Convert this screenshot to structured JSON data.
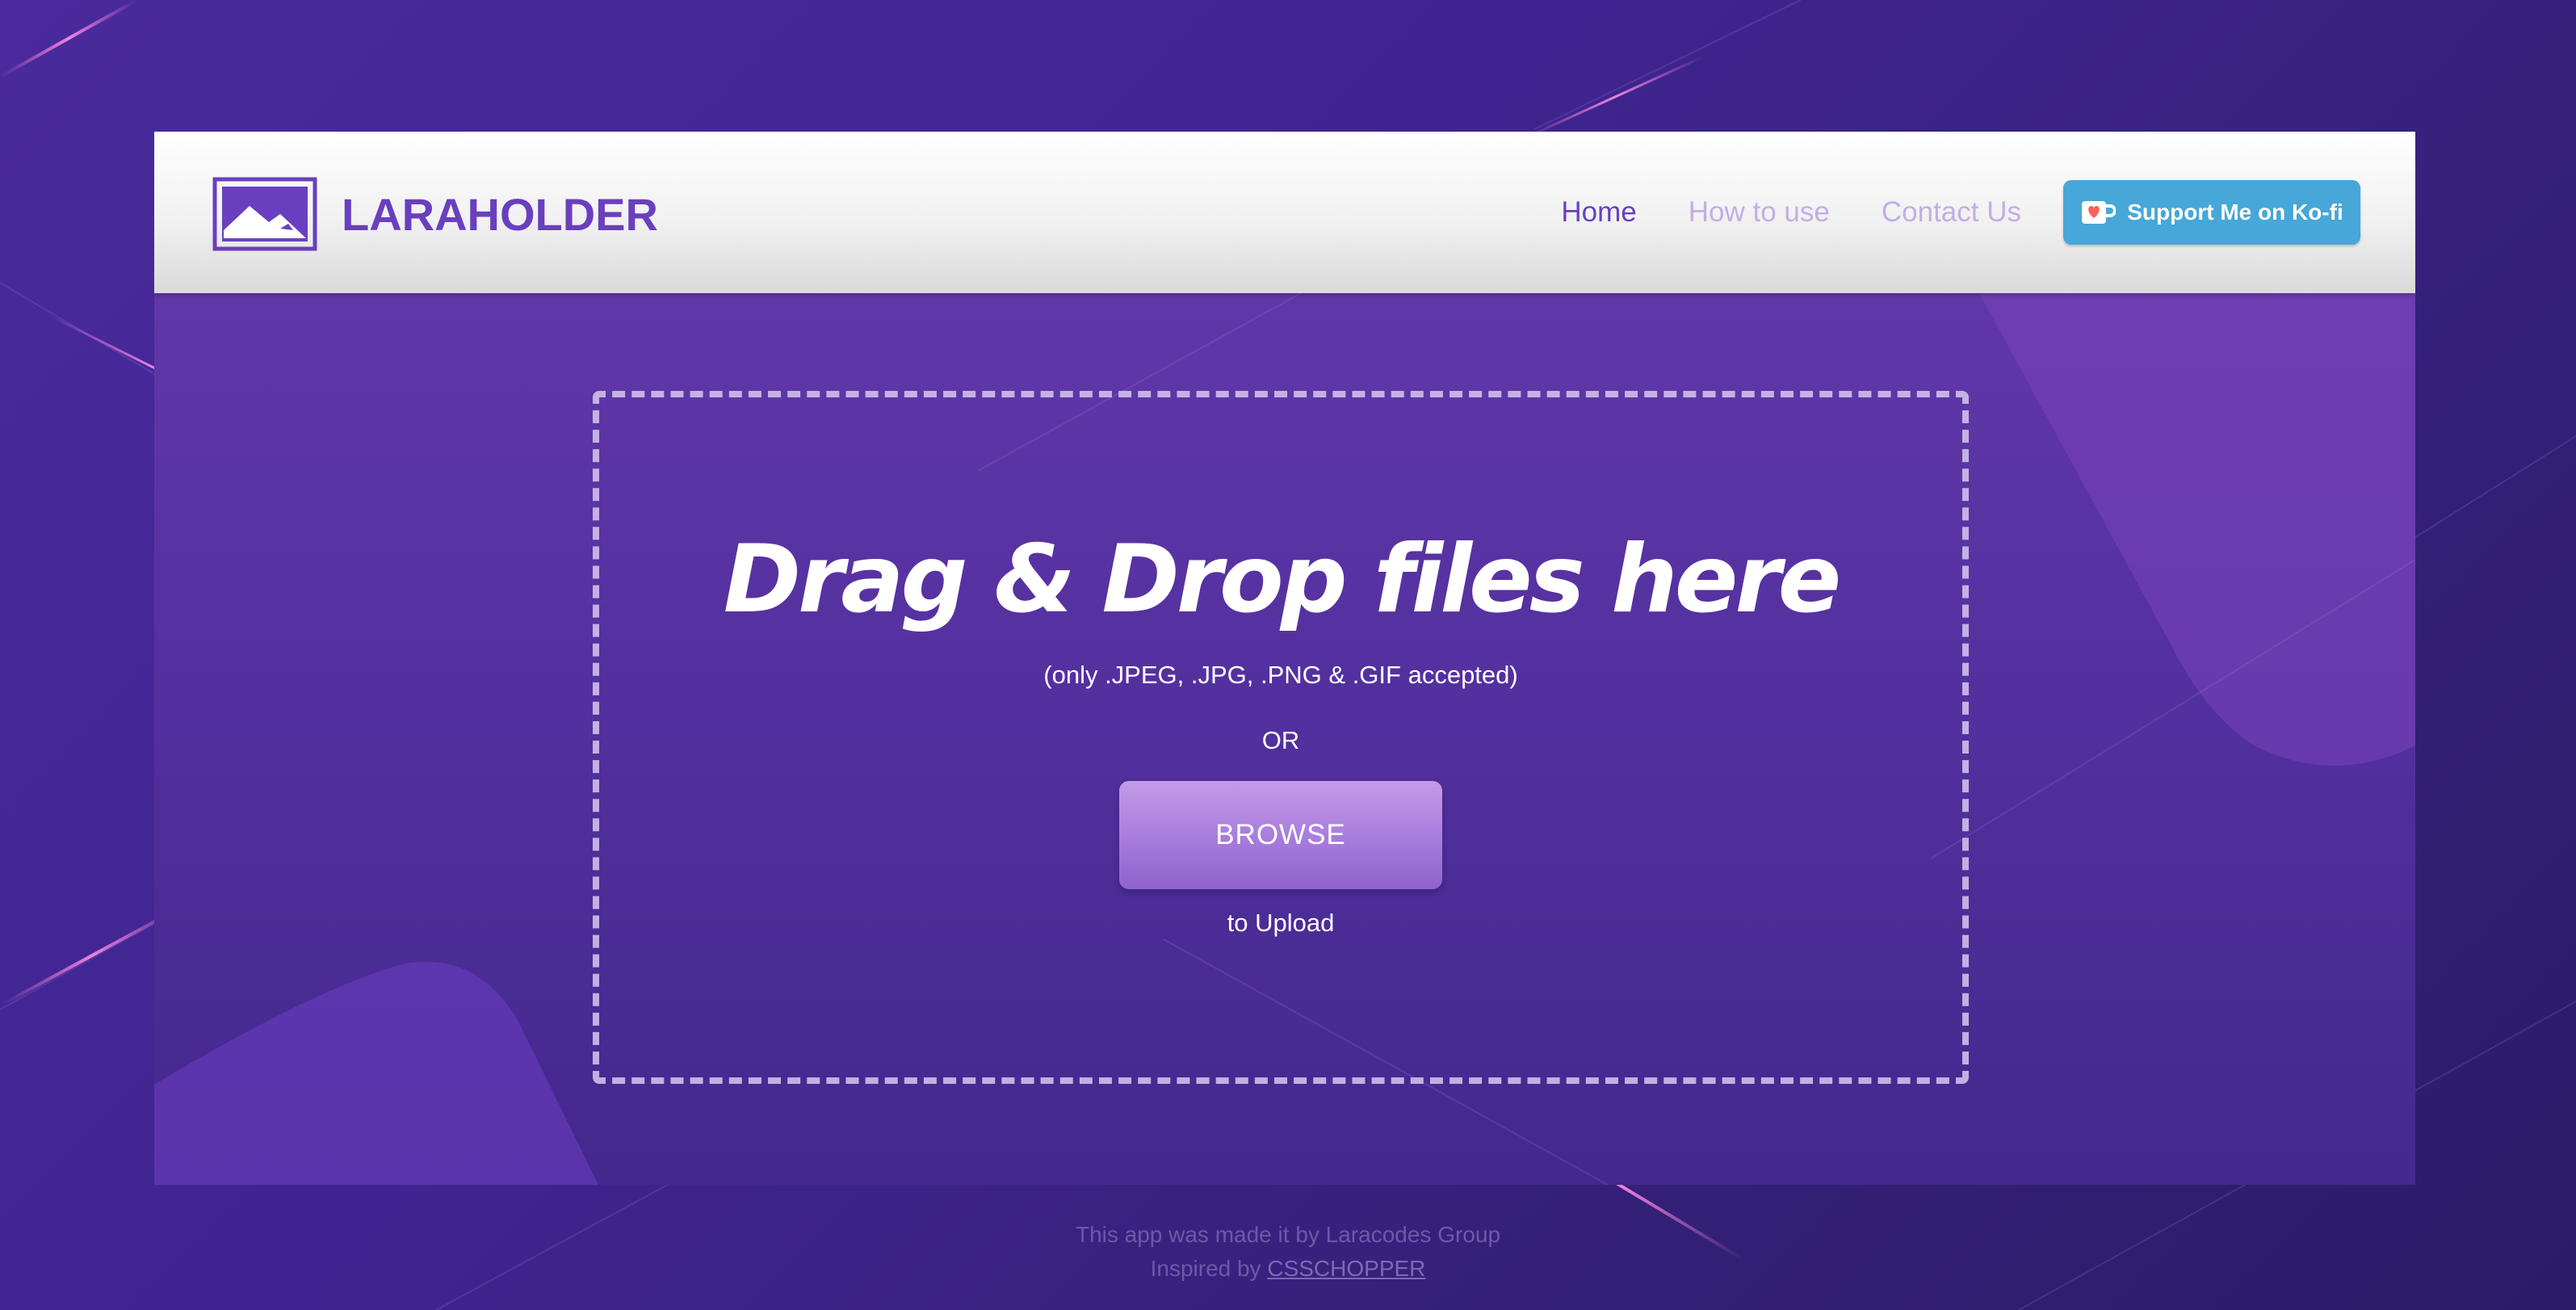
{
  "header": {
    "brand": "LARAHOLDER",
    "nav": [
      {
        "label": "Home",
        "active": true
      },
      {
        "label": "How to use",
        "active": false
      },
      {
        "label": "Contact Us",
        "active": false
      }
    ],
    "kofi_label": "Support Me on Ko-fi",
    "logo_icon": "image-mountain-icon",
    "kofi_icon": "coffee-cup-heart-icon"
  },
  "dropzone": {
    "title": "Drag & Drop files here",
    "accepted": "(only .JPEG, .JPG, .PNG & .GIF accepted)",
    "or_text": "OR",
    "browse_label": "BROWSE",
    "upload_text": "to Upload"
  },
  "footer": {
    "credit": "This app was made it by Laracodes Group",
    "inspired_prefix": "Inspired by",
    "inspired_link": "CSSCHOPPER"
  },
  "colors": {
    "brand": "#6a3fbf",
    "nav_inactive": "#c3ade6",
    "kofi_blue": "#46a7d8",
    "page_bg": "#3f2590",
    "button": "#a77bdc"
  }
}
